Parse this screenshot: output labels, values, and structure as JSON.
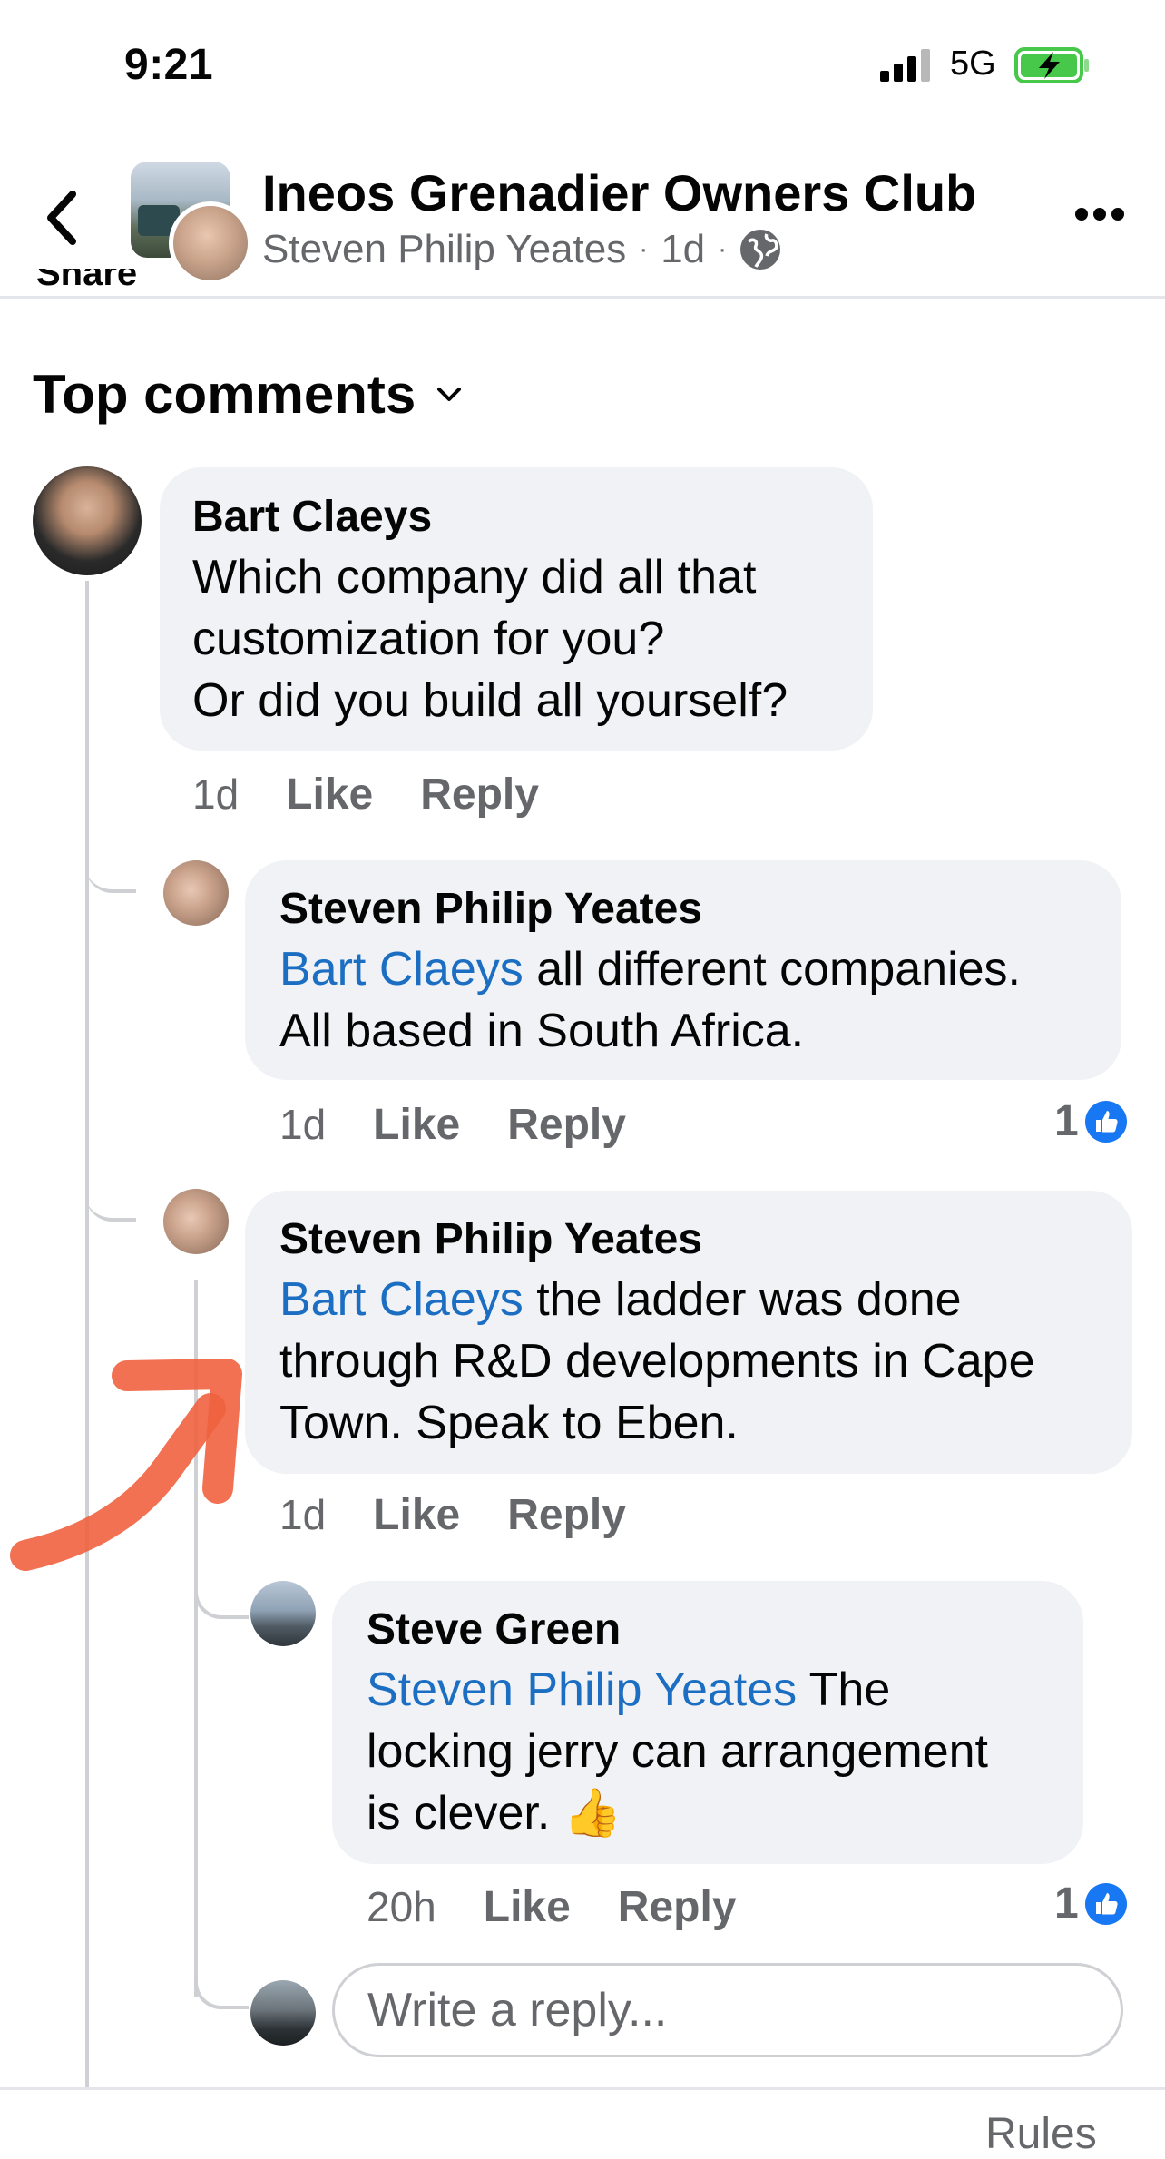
{
  "status_bar": {
    "time": "9:21",
    "network": "5G"
  },
  "header": {
    "group_name": "Ineos Grenadier Owners Club",
    "author": "Steven Philip Yeates",
    "age": "1d",
    "separator": "·"
  },
  "share_peek": "Share",
  "sort_label": "Top comments",
  "comments": [
    {
      "author": "Bart Claeys",
      "lines": [
        "Which company did all that",
        "customization for you?",
        "Or did you build all yourself?"
      ],
      "time": "1d",
      "like": "Like",
      "reply": "Reply"
    },
    {
      "author": "Steven Philip Yeates",
      "mention": "Bart Claeys",
      "line1_rest": " all different companies.",
      "line2": "All based in South Africa.",
      "time": "1d",
      "like": "Like",
      "reply": "Reply",
      "reactions": "1"
    },
    {
      "author": "Steven Philip Yeates",
      "mention": "Bart Claeys",
      "line1_rest": " the ladder was done",
      "line2": "through R&D developments in Cape",
      "line3": "Town. Speak to Eben.",
      "time": "1d",
      "like": "Like",
      "reply": "Reply"
    },
    {
      "author": "Steve Green",
      "mention": "Steven Philip Yeates",
      "line1_rest": " The",
      "line2": "locking jerry can arrangement",
      "line3": "is clever. 👍",
      "time": "20h",
      "like": "Like",
      "reply": "Reply",
      "reactions": "1"
    }
  ],
  "reply_input": {
    "placeholder": "Write a reply..."
  },
  "footer": {
    "rules": "Rules"
  },
  "colors": {
    "mention": "#1b6ec2",
    "like_badge": "#1877f2",
    "annotation": "#f0623f"
  },
  "icons": [
    "back-chevron-icon",
    "globe-icon",
    "more-icon",
    "chevron-down-icon",
    "like-reaction-icon",
    "signal-icon",
    "battery-charging-icon"
  ]
}
